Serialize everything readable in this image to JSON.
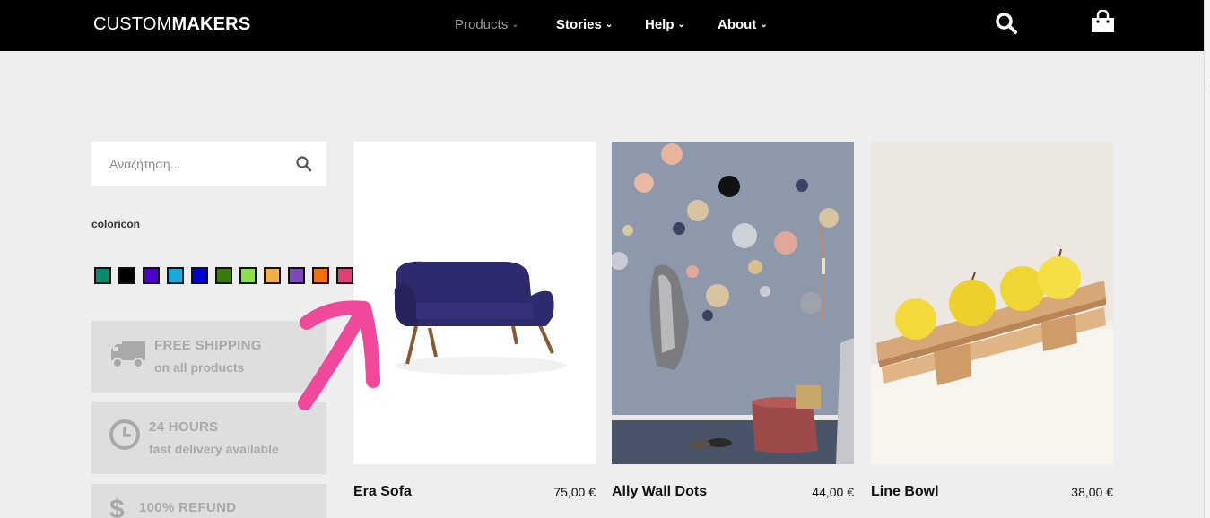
{
  "brand": {
    "light": "CUSTOM",
    "bold": "MAKERS"
  },
  "nav": [
    {
      "label": "Products",
      "active": true
    },
    {
      "label": "Stories",
      "active": false
    },
    {
      "label": "Help",
      "active": false
    },
    {
      "label": "About",
      "active": false
    }
  ],
  "header_icons": [
    "search-icon",
    "shopping-bag-icon"
  ],
  "search": {
    "placeholder": "Αναζήτηση..."
  },
  "filter": {
    "title": "coloricon",
    "swatches": [
      "#0b8a6c",
      "#000000",
      "#4b00c8",
      "#1aa8d8",
      "#0000d0",
      "#3b7a10",
      "#8ee04a",
      "#f2b04a",
      "#7a4ab8",
      "#f07010",
      "#e0407a"
    ]
  },
  "promos": [
    {
      "title": "FREE SHIPPING",
      "subtitle": "on all products",
      "icon": "truck-icon"
    },
    {
      "title": "24 HOURS",
      "subtitle": "fast delivery available",
      "icon": "clock-icon"
    },
    {
      "title": "100% REFUND",
      "subtitle": "",
      "icon": "dollar-icon"
    }
  ],
  "products": [
    {
      "name": "Era Sofa",
      "price": "75,00 €"
    },
    {
      "name": "Ally Wall Dots",
      "price": "44,00 €"
    },
    {
      "name": "Line Bowl",
      "price": "38,00 €"
    }
  ],
  "colors": {
    "header_bg": "#000000",
    "page_bg": "#eeeeee",
    "promo_bg": "#dedede",
    "annotation": "#f0489a"
  }
}
